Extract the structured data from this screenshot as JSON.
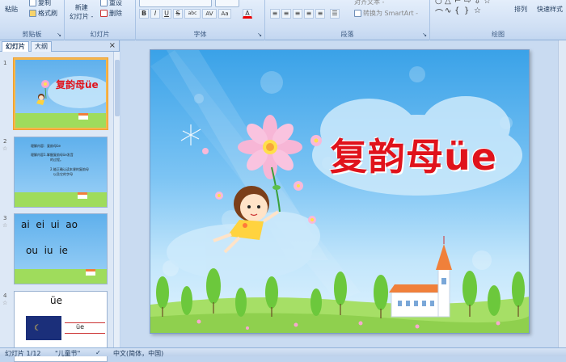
{
  "ribbon": {
    "clipboard": {
      "paste": "粘贴",
      "copy": "复制",
      "format_painter": "格式刷",
      "label": "剪贴板"
    },
    "slides": {
      "new_slide_line1": "新建",
      "new_slide_line2": "幻灯片 -",
      "reset": "重设",
      "delete": "删除",
      "label": "幻灯片"
    },
    "font": {
      "label": "字体"
    },
    "paragraph": {
      "align_text": "对齐文本 -",
      "convert_smartart": "转换为 SmartArt -",
      "label": "段落"
    },
    "drawing": {
      "arrange": "排列",
      "quick_styles": "快速样式",
      "label": "绘图"
    },
    "font_buttons": [
      "B",
      "I",
      "U",
      "S",
      "abc",
      "AV",
      "Aa",
      "A"
    ],
    "para_buttons": [
      "≡",
      "≡",
      "≡",
      "≡",
      "≡",
      "☰"
    ],
    "shape_glyphs_row1": [
      "○",
      "△",
      "⌐",
      "⇨",
      "⇩",
      "☆"
    ],
    "shape_glyphs_row2": [
      "⌒",
      "∿",
      "{",
      "}",
      "☆"
    ]
  },
  "panel": {
    "tab_slides": "幻灯片",
    "tab_outline": "大纲",
    "close": "×",
    "thumbnails": [
      {
        "num": "1",
        "title": "复韵母üe"
      },
      {
        "num": "2",
        "title": "理解内容：复韵母üe",
        "lines": [
          "理解内容1.掌握复韵母üe发音",
          "的过程。",
          "2.能正确认读本课的复韵母",
          "以及它的字母"
        ]
      },
      {
        "num": "3",
        "text_line1": "ai  ei  ui  ao",
        "text_line2": "ou  iu  ie"
      },
      {
        "num": "4",
        "text_line1": "üe",
        "text_line2": "üe"
      }
    ]
  },
  "slide": {
    "title": "复韵母üe"
  },
  "status": {
    "slide_info": "幻灯片 1/12",
    "theme": "\"儿童节\"",
    "language": "中文(简体，中国)"
  },
  "colors": {
    "title_red": "#e0131c",
    "sky_top": "#3aa2e8",
    "grass": "#9fdc5c",
    "selected_border": "#f6b64a"
  }
}
